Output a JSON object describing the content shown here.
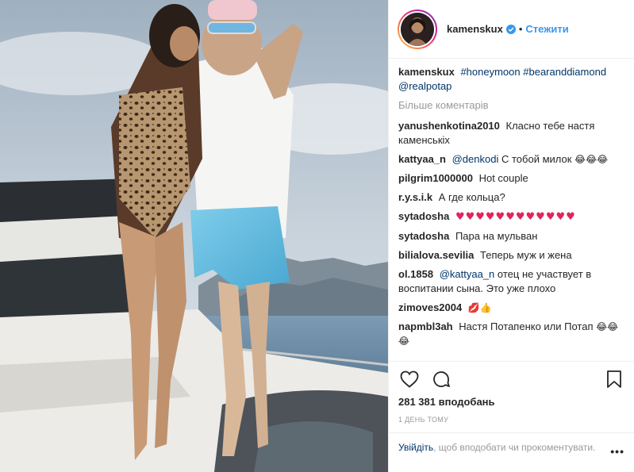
{
  "post": {
    "username": "kamenskux",
    "separator": "•",
    "follow_label": "Стежити",
    "caption": {
      "user": "kamenskux",
      "tags": [
        "#honeymoon",
        "#bearanddiamond",
        "@realpotap"
      ]
    },
    "more_comments_label": "Більше коментарів",
    "comments": [
      {
        "user": "yanushenkotina2010",
        "text": "Класно тебе настя каменськіх"
      },
      {
        "user": "kattyaa_n",
        "mention": "@denkodi",
        "text": "С тобой милок",
        "emoji": "😂😂😂"
      },
      {
        "user": "pilgrim1000000",
        "text": "Hot couple"
      },
      {
        "user": "r.y.s.i.k",
        "text": "А где кольца?"
      },
      {
        "user": "sytadosha",
        "emoji": "♥♥♥♥♥♥♥♥♥♥♥♥"
      },
      {
        "user": "sytadosha",
        "text": "Пара на мульван"
      },
      {
        "user": "bilialova.sevilia",
        "text": "Теперь муж и жена"
      },
      {
        "user": "ol.1858",
        "mention": "@kattyaa_n",
        "text": "отец не участвует в воспитании сына. Это уже плохо"
      },
      {
        "user": "zimoves2004",
        "emoji": "💋👍"
      },
      {
        "user": "napmbl3ah",
        "text": "Настя Потапенко или Потап",
        "emoji": "😂😂😂"
      }
    ],
    "likes": "281 381 вподобань",
    "time_ago": "1 ДЕНЬ ТОМУ",
    "login_link": "Увійдіть",
    "login_text": ", щоб вподобати чи прокоментувати.",
    "more_options": "•••"
  },
  "icons": {
    "like": "heart-icon",
    "comment": "comment-bubble-icon",
    "share": "share-paper-plane-icon",
    "save": "bookmark-icon",
    "verified": "verified-badge-icon"
  },
  "colors": {
    "link_blue": "#3897f0",
    "tag_blue": "#003569",
    "muted_gray": "#999999",
    "text": "#262626",
    "border": "#efefef"
  }
}
